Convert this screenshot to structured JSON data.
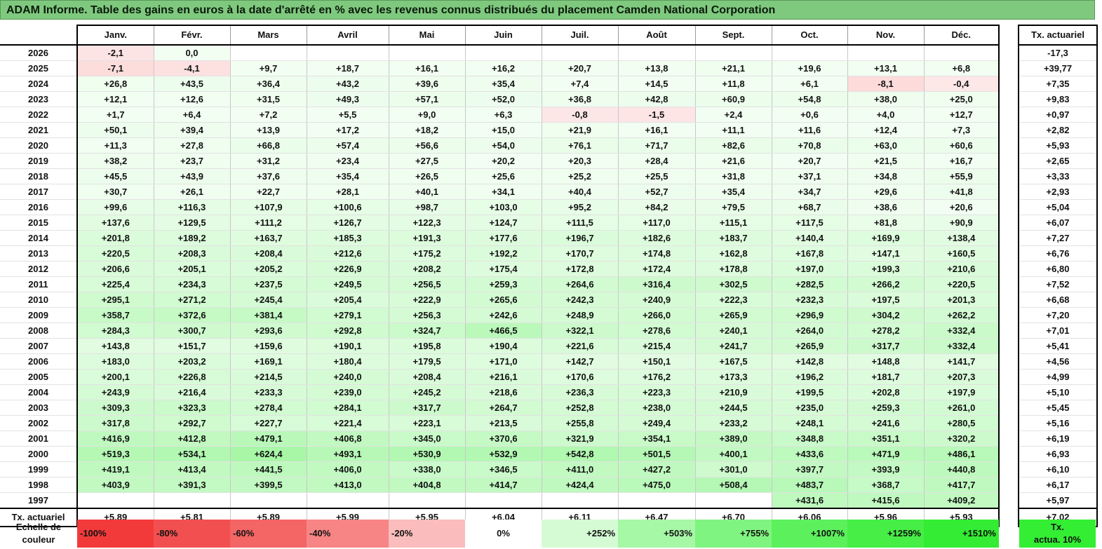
{
  "title": "ADAM Informe. Table des gains en euros à la date d'arrêté en % avec les revenus connus distribués du placement Camden National Corporation",
  "months": [
    "Janv.",
    "Févr.",
    "Mars",
    "Avril",
    "Mai",
    "Juin",
    "Juil.",
    "Août",
    "Sept.",
    "Oct.",
    "Nov.",
    "Déc."
  ],
  "side_header": "Tx. actuariel",
  "total_label": "Tx. actuariel",
  "rows": [
    {
      "year": "2026",
      "values": [
        "-2,1",
        "0,0",
        "",
        "",
        "",
        "",
        "",
        "",
        "",
        "",
        "",
        ""
      ],
      "rate": "-17,3"
    },
    {
      "year": "2025",
      "values": [
        "-7,1",
        "-4,1",
        "+9,7",
        "+18,7",
        "+16,1",
        "+16,2",
        "+20,7",
        "+13,8",
        "+21,1",
        "+19,6",
        "+13,1",
        "+6,8"
      ],
      "rate": "+39,77"
    },
    {
      "year": "2024",
      "values": [
        "+26,8",
        "+43,5",
        "+36,4",
        "+43,2",
        "+39,6",
        "+35,4",
        "+7,4",
        "+14,5",
        "+11,8",
        "+6,1",
        "-8,1",
        "-0,4"
      ],
      "rate": "+7,35"
    },
    {
      "year": "2023",
      "values": [
        "+12,1",
        "+12,6",
        "+31,5",
        "+49,3",
        "+57,1",
        "+52,0",
        "+36,8",
        "+42,8",
        "+60,9",
        "+54,8",
        "+38,0",
        "+25,0"
      ],
      "rate": "+9,83"
    },
    {
      "year": "2022",
      "values": [
        "+1,7",
        "+6,4",
        "+7,2",
        "+5,5",
        "+9,0",
        "+6,3",
        "-0,8",
        "-1,5",
        "+2,4",
        "+0,6",
        "+4,0",
        "+12,7"
      ],
      "rate": "+0,97"
    },
    {
      "year": "2021",
      "values": [
        "+50,1",
        "+39,4",
        "+13,9",
        "+17,2",
        "+18,2",
        "+15,0",
        "+21,9",
        "+16,1",
        "+11,1",
        "+11,6",
        "+12,4",
        "+7,3"
      ],
      "rate": "+2,82"
    },
    {
      "year": "2020",
      "values": [
        "+11,3",
        "+27,8",
        "+66,8",
        "+57,4",
        "+56,6",
        "+54,0",
        "+76,1",
        "+71,7",
        "+82,6",
        "+70,8",
        "+63,0",
        "+60,6"
      ],
      "rate": "+5,93"
    },
    {
      "year": "2019",
      "values": [
        "+38,2",
        "+23,7",
        "+31,2",
        "+23,4",
        "+27,5",
        "+20,2",
        "+20,3",
        "+28,4",
        "+21,6",
        "+20,7",
        "+21,5",
        "+16,7"
      ],
      "rate": "+2,65"
    },
    {
      "year": "2018",
      "values": [
        "+45,5",
        "+43,9",
        "+37,6",
        "+35,4",
        "+26,5",
        "+25,6",
        "+25,2",
        "+25,5",
        "+31,8",
        "+37,1",
        "+34,8",
        "+55,9"
      ],
      "rate": "+3,33"
    },
    {
      "year": "2017",
      "values": [
        "+30,7",
        "+26,1",
        "+22,7",
        "+28,1",
        "+40,1",
        "+34,1",
        "+40,4",
        "+52,7",
        "+35,4",
        "+34,7",
        "+29,6",
        "+41,8"
      ],
      "rate": "+2,93"
    },
    {
      "year": "2016",
      "values": [
        "+99,6",
        "+116,3",
        "+107,9",
        "+100,6",
        "+98,7",
        "+103,0",
        "+95,2",
        "+84,2",
        "+79,5",
        "+68,7",
        "+38,6",
        "+20,6"
      ],
      "rate": "+5,04"
    },
    {
      "year": "2015",
      "values": [
        "+137,6",
        "+129,5",
        "+111,2",
        "+126,7",
        "+122,3",
        "+124,7",
        "+111,5",
        "+117,0",
        "+115,1",
        "+117,5",
        "+81,8",
        "+90,9"
      ],
      "rate": "+6,07"
    },
    {
      "year": "2014",
      "values": [
        "+201,8",
        "+189,2",
        "+163,7",
        "+185,3",
        "+191,3",
        "+177,6",
        "+196,7",
        "+182,6",
        "+183,7",
        "+140,4",
        "+169,9",
        "+138,4"
      ],
      "rate": "+7,27"
    },
    {
      "year": "2013",
      "values": [
        "+220,5",
        "+208,3",
        "+208,4",
        "+212,6",
        "+175,2",
        "+192,2",
        "+170,7",
        "+174,8",
        "+162,8",
        "+167,8",
        "+147,1",
        "+160,5"
      ],
      "rate": "+6,76"
    },
    {
      "year": "2012",
      "values": [
        "+206,6",
        "+205,1",
        "+205,2",
        "+226,9",
        "+208,2",
        "+175,4",
        "+172,8",
        "+172,4",
        "+178,8",
        "+197,0",
        "+199,3",
        "+210,6"
      ],
      "rate": "+6,80"
    },
    {
      "year": "2011",
      "values": [
        "+225,4",
        "+234,3",
        "+237,5",
        "+249,5",
        "+256,5",
        "+259,3",
        "+264,6",
        "+316,4",
        "+302,5",
        "+282,5",
        "+266,2",
        "+220,5"
      ],
      "rate": "+7,52"
    },
    {
      "year": "2010",
      "values": [
        "+295,1",
        "+271,2",
        "+245,4",
        "+205,4",
        "+222,9",
        "+265,6",
        "+242,3",
        "+240,9",
        "+222,3",
        "+232,3",
        "+197,5",
        "+201,3"
      ],
      "rate": "+6,68"
    },
    {
      "year": "2009",
      "values": [
        "+358,7",
        "+372,6",
        "+381,4",
        "+279,1",
        "+256,3",
        "+242,6",
        "+248,9",
        "+266,0",
        "+265,9",
        "+296,9",
        "+304,2",
        "+262,2"
      ],
      "rate": "+7,20"
    },
    {
      "year": "2008",
      "values": [
        "+284,3",
        "+300,7",
        "+293,6",
        "+292,8",
        "+324,7",
        "+466,5",
        "+322,1",
        "+278,6",
        "+240,1",
        "+264,0",
        "+278,2",
        "+332,4"
      ],
      "rate": "+7,01"
    },
    {
      "year": "2007",
      "values": [
        "+143,8",
        "+151,7",
        "+159,6",
        "+190,1",
        "+195,8",
        "+190,4",
        "+221,6",
        "+215,4",
        "+241,7",
        "+265,9",
        "+317,7",
        "+332,4"
      ],
      "rate": "+5,41"
    },
    {
      "year": "2006",
      "values": [
        "+183,0",
        "+203,2",
        "+169,1",
        "+180,4",
        "+179,5",
        "+171,0",
        "+142,7",
        "+150,1",
        "+167,5",
        "+142,8",
        "+148,8",
        "+141,7"
      ],
      "rate": "+4,56"
    },
    {
      "year": "2005",
      "values": [
        "+200,1",
        "+226,8",
        "+214,5",
        "+240,0",
        "+208,4",
        "+216,1",
        "+170,6",
        "+176,2",
        "+173,3",
        "+196,2",
        "+181,7",
        "+207,3"
      ],
      "rate": "+4,99"
    },
    {
      "year": "2004",
      "values": [
        "+243,9",
        "+216,4",
        "+233,3",
        "+239,0",
        "+245,2",
        "+218,6",
        "+236,3",
        "+223,3",
        "+210,9",
        "+199,5",
        "+202,8",
        "+197,9"
      ],
      "rate": "+5,10"
    },
    {
      "year": "2003",
      "values": [
        "+309,3",
        "+323,3",
        "+278,4",
        "+284,1",
        "+317,7",
        "+264,7",
        "+252,8",
        "+238,0",
        "+244,5",
        "+235,0",
        "+259,3",
        "+261,0"
      ],
      "rate": "+5,45"
    },
    {
      "year": "2002",
      "values": [
        "+317,8",
        "+292,7",
        "+227,7",
        "+221,4",
        "+223,1",
        "+213,5",
        "+255,8",
        "+249,4",
        "+233,2",
        "+248,1",
        "+241,6",
        "+280,5"
      ],
      "rate": "+5,16"
    },
    {
      "year": "2001",
      "values": [
        "+416,9",
        "+412,8",
        "+479,1",
        "+406,8",
        "+345,0",
        "+370,6",
        "+321,9",
        "+354,1",
        "+389,0",
        "+348,8",
        "+351,1",
        "+320,2"
      ],
      "rate": "+6,19"
    },
    {
      "year": "2000",
      "values": [
        "+519,3",
        "+534,1",
        "+624,4",
        "+493,1",
        "+530,9",
        "+532,9",
        "+542,8",
        "+501,5",
        "+400,1",
        "+433,6",
        "+471,9",
        "+486,1"
      ],
      "rate": "+6,93"
    },
    {
      "year": "1999",
      "values": [
        "+419,1",
        "+413,4",
        "+441,5",
        "+406,0",
        "+338,0",
        "+346,5",
        "+411,0",
        "+427,2",
        "+301,0",
        "+397,7",
        "+393,9",
        "+440,8"
      ],
      "rate": "+6,10"
    },
    {
      "year": "1998",
      "values": [
        "+403,9",
        "+391,3",
        "+399,5",
        "+413,0",
        "+404,8",
        "+414,7",
        "+424,4",
        "+475,0",
        "+508,4",
        "+483,7",
        "+368,7",
        "+417,7"
      ],
      "rate": "+6,17"
    },
    {
      "year": "1997",
      "values": [
        "",
        "",
        "",
        "",
        "",
        "",
        "",
        "",
        "",
        "+431,6",
        "+415,6",
        "+409,2"
      ],
      "rate": "+5,97"
    }
  ],
  "totals": [
    "+5,89",
    "+5,81",
    "+5,89",
    "+5,99",
    "+5,95",
    "+6,04",
    "+6,11",
    "+6,47",
    "+6,70",
    "+6,06",
    "+5,96",
    "+5,93"
  ],
  "total_rate": "+7,02",
  "legend": {
    "label_line1": "Echelle de",
    "label_line2": "couleur",
    "items": [
      {
        "label": "-100%",
        "color": "#f23a3a"
      },
      {
        "label": "-80%",
        "color": "#f25050"
      },
      {
        "label": "-60%",
        "color": "#f46565"
      },
      {
        "label": "-40%",
        "color": "#f78585"
      },
      {
        "label": "-20%",
        "color": "#fabcbc"
      },
      {
        "label": "0%",
        "color": "#ffffff"
      },
      {
        "label": "+252%",
        "color": "#d4fbd4"
      },
      {
        "label": "+503%",
        "color": "#a6f7a6"
      },
      {
        "label": "+755%",
        "color": "#80f480"
      },
      {
        "label": "+1007%",
        "color": "#5cf05c"
      },
      {
        "label": "+1259%",
        "color": "#46ee46"
      },
      {
        "label": "+1510%",
        "color": "#33ec33"
      }
    ],
    "actua_line1": "Tx.",
    "actua_line2": "actua. 10%",
    "actua_color": "#33ee33"
  }
}
